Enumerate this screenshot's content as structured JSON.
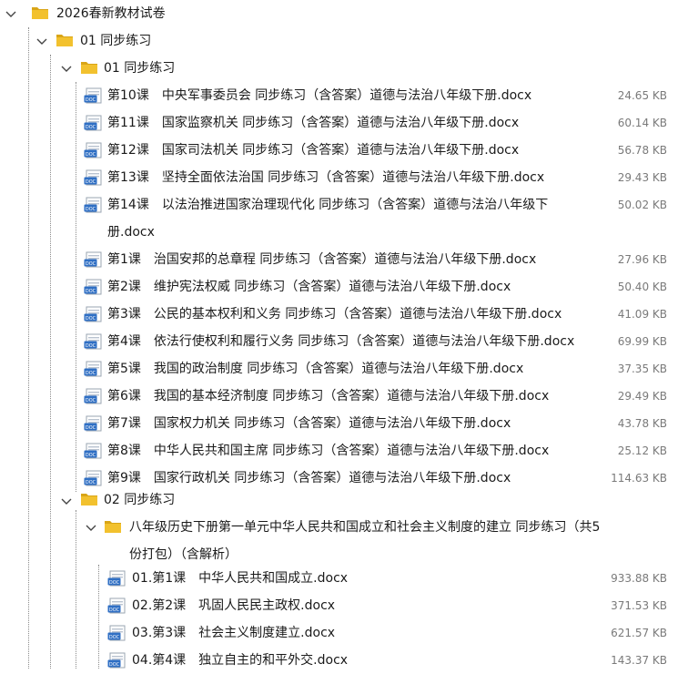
{
  "tree": {
    "root": {
      "name": "2026春新教材试卷"
    },
    "level1": {
      "name": "01 同步练习"
    },
    "level2a": {
      "name": "01 同步练习"
    },
    "files_a": [
      {
        "name": "第10课　中央军事委员会 同步练习（含答案）道德与法治八年级下册.docx",
        "size": "24.65 KB"
      },
      {
        "name": "第11课　国家监察机关 同步练习（含答案）道德与法治八年级下册.docx",
        "size": "60.14 KB"
      },
      {
        "name": "第12课　国家司法机关 同步练习（含答案）道德与法治八年级下册.docx",
        "size": "56.78 KB"
      },
      {
        "name": "第13课　坚持全面依法治国 同步练习（含答案）道德与法治八年级下册.docx",
        "size": "29.43 KB"
      },
      {
        "name": "第14课　以法治推进国家治理现代化 同步练习（含答案）道德与法治八年级下册.docx",
        "size": "50.02 KB"
      },
      {
        "name": "第1课　治国安邦的总章程 同步练习（含答案）道德与法治八年级下册.docx",
        "size": "27.96 KB"
      },
      {
        "name": "第2课　维护宪法权威 同步练习（含答案）道德与法治八年级下册.docx",
        "size": "50.40 KB"
      },
      {
        "name": "第3课　公民的基本权利和义务 同步练习（含答案）道德与法治八年级下册.docx",
        "size": "41.09 KB"
      },
      {
        "name": "第4课　依法行使权利和履行义务 同步练习（含答案）道德与法治八年级下册.docx",
        "size": "69.99 KB"
      },
      {
        "name": "第5课　我国的政治制度 同步练习（含答案）道德与法治八年级下册.docx",
        "size": "37.35 KB"
      },
      {
        "name": "第6课　我国的基本经济制度 同步练习（含答案）道德与法治八年级下册.docx",
        "size": "29.49 KB"
      },
      {
        "name": "第7课　国家权力机关 同步练习（含答案）道德与法治八年级下册.docx",
        "size": "43.78 KB"
      },
      {
        "name": "第8课　中华人民共和国主席 同步练习（含答案）道德与法治八年级下册.docx",
        "size": "25.12 KB"
      },
      {
        "name": "第9课　国家行政机关 同步练习（含答案）道德与法治八年级下册.docx",
        "size": "114.63 KB"
      }
    ],
    "level2b": {
      "name": "02 同步练习"
    },
    "level3": {
      "name": "八年级历史下册第一单元中华人民共和国成立和社会主义制度的建立 同步练习（共5份打包）（含解析）"
    },
    "files_b": [
      {
        "name": "01.第1课　中华人民共和国成立.docx",
        "size": "933.88 KB"
      },
      {
        "name": "02.第2课　巩固人民民主政权.docx",
        "size": "371.53 KB"
      },
      {
        "name": "03.第3课　社会主义制度建立.docx",
        "size": "621.57 KB"
      },
      {
        "name": "04.第4课　独立自主的和平外交.docx",
        "size": "143.37 KB"
      }
    ]
  },
  "colors": {
    "folder": "#f2c12e",
    "folder_dark": "#d9a517",
    "doc_blue": "#2f6fc4",
    "size_text": "#7a7a7a"
  }
}
